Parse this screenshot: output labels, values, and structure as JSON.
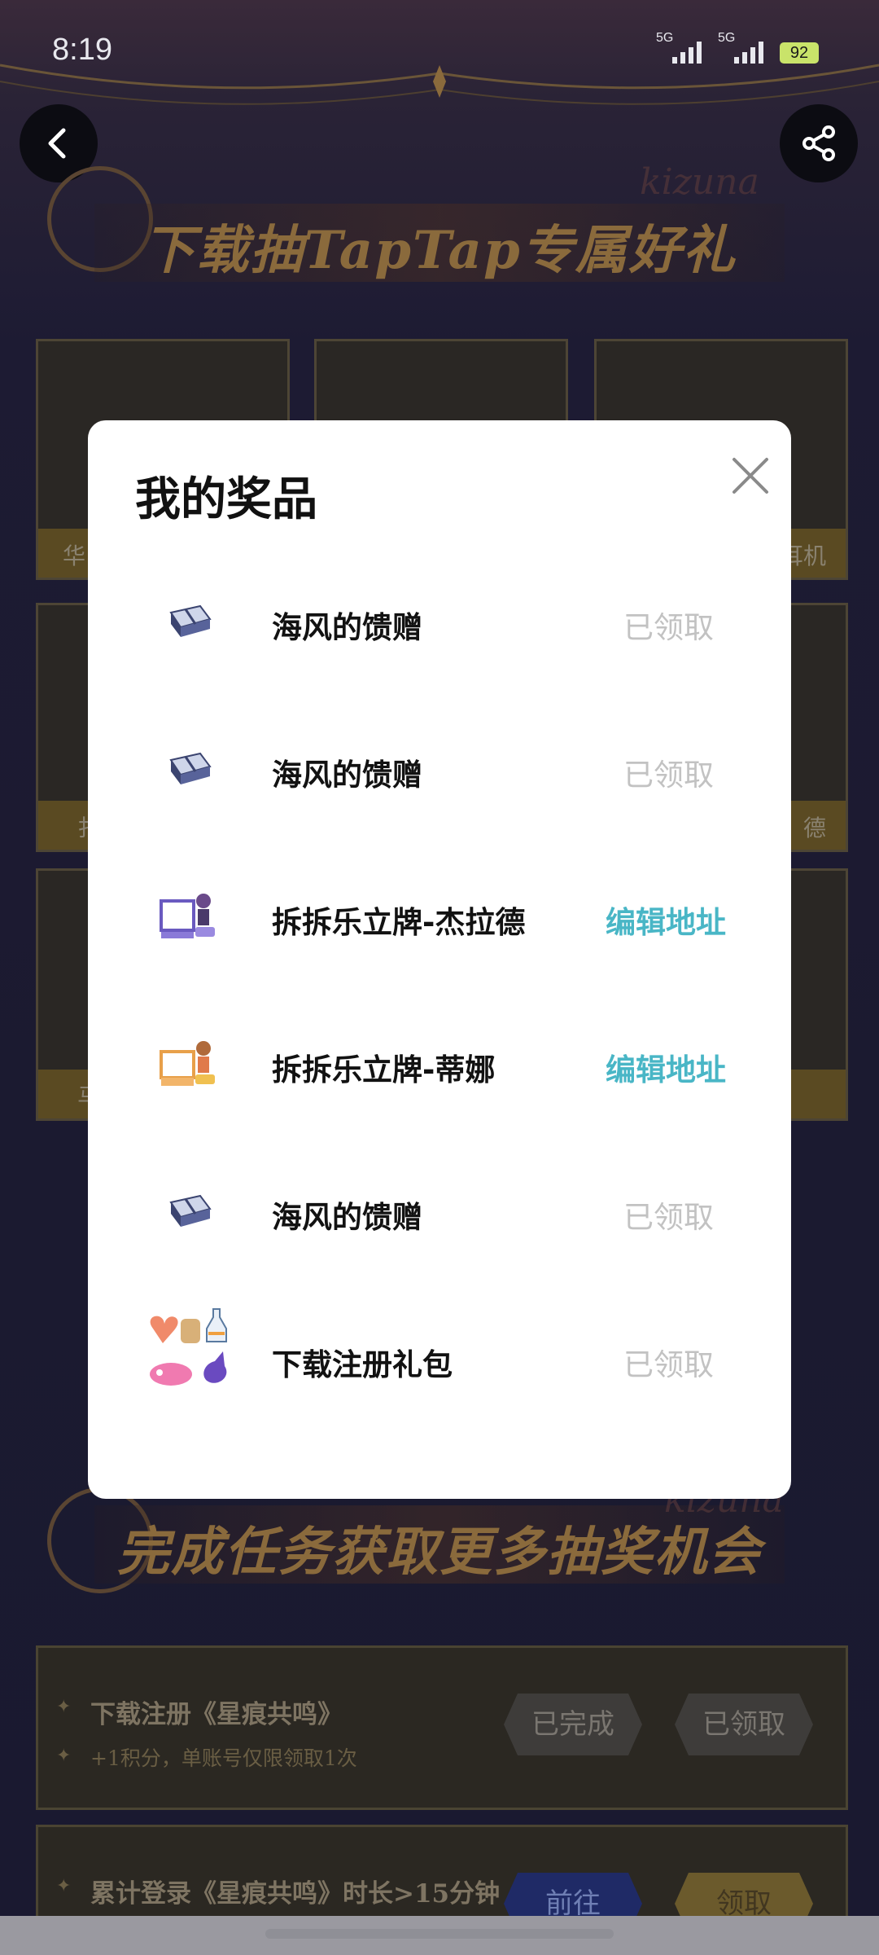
{
  "status_bar": {
    "time": "8:19",
    "signal_1": "5G",
    "signal_2": "5G",
    "battery": "92"
  },
  "background": {
    "banner_title": "下载抽TapTap专属好礼",
    "banner_script": "kizuna",
    "prize_labels": {
      "left_top": "华",
      "right_top": "耳机",
      "left_mid": "扌",
      "right_mid": "德",
      "left_low": "马"
    },
    "section_title": "完成任务获取更多抽奖机会",
    "section_script": "kizuna",
    "tasks": [
      {
        "title": "下载注册《星痕共鸣》",
        "subtitle": "+1积分，单账号仅限领取1次",
        "btn1": "已完成",
        "btn2": "已领取"
      },
      {
        "title": "累计登录《星痕共鸣》时长>15分钟",
        "btn1": "前往",
        "btn2": "领取"
      }
    ]
  },
  "modal": {
    "title": "我的奖品",
    "prizes": [
      {
        "name": "海风的馈赠",
        "status": "已领取",
        "status_type": "claimed",
        "icon": "gift-box-icon"
      },
      {
        "name": "海风的馈赠",
        "status": "已领取",
        "status_type": "claimed",
        "icon": "gift-box-icon"
      },
      {
        "name": "拆拆乐立牌-杰拉德",
        "status": "编辑地址",
        "status_type": "edit",
        "icon": "acrylic-stand-purple-icon"
      },
      {
        "name": "拆拆乐立牌-蒂娜",
        "status": "编辑地址",
        "status_type": "edit",
        "icon": "acrylic-stand-orange-icon"
      },
      {
        "name": "海风的馈赠",
        "status": "已领取",
        "status_type": "claimed",
        "icon": "gift-box-icon"
      },
      {
        "name": "下载注册礼包",
        "status": "已领取",
        "status_type": "claimed",
        "icon": "gift-pack-icon"
      }
    ]
  },
  "colors": {
    "accent_edit": "#49b6c6",
    "claimed_gray": "#c2c2c2"
  }
}
